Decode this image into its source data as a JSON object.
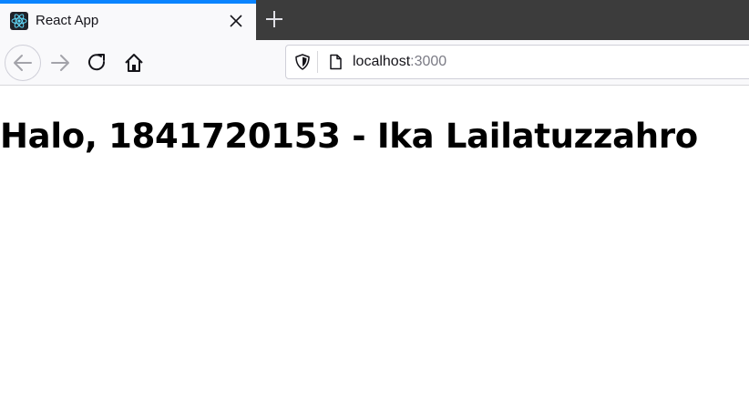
{
  "browser": {
    "tab": {
      "title": "React App",
      "favicon": "react-logo-icon",
      "accent_color": "#0a84ff"
    },
    "url": {
      "host": "localhost",
      "port": ":3000"
    },
    "icons": {
      "back": "arrow-left-icon",
      "forward": "arrow-right-icon",
      "reload": "reload-icon",
      "home": "home-icon",
      "shield": "shield-icon",
      "page": "page-icon",
      "close": "close-icon",
      "new_tab": "plus-icon"
    }
  },
  "page": {
    "heading": "Halo, 1841720153 - Ika Lailatuzzahro"
  }
}
